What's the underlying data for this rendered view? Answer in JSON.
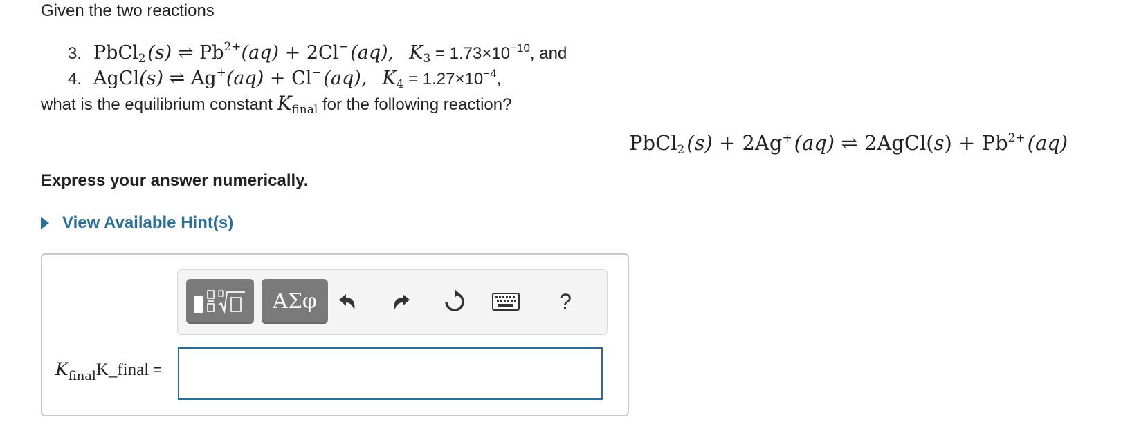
{
  "intro": "Given the two reactions",
  "reactions": [
    {
      "num": "3.",
      "left": "PbCl",
      "left_sub": "2",
      "state1": "(s)",
      "prod1": "Pb",
      "prod1_sup": "2+",
      "aq1": "(aq)",
      "plus": "+",
      "prod2": "2Cl",
      "prod2_sup": "−",
      "aq2": "(aq),",
      "k": "K",
      "k_sub": "3",
      "kval": " = 1.73×10",
      "kval_sup": "−10",
      "tail": ", and"
    },
    {
      "num": "4.",
      "left": "AgCl",
      "state1": "(s)",
      "prod1": "Ag",
      "prod1_sup": "+",
      "aq1": "(aq)",
      "plus": "+",
      "prod2": "Cl",
      "prod2_sup": "−",
      "aq2": "(aq),",
      "k": "K",
      "k_sub": "4",
      "kval": " = 1.27×10",
      "kval_sup": "−4",
      "tail": ","
    }
  ],
  "question": {
    "before": "what is the equilibrium constant ",
    "k": "K",
    "k_sub": "final",
    "after": " for the following reaction?"
  },
  "final_reaction": {
    "a": "PbCl",
    "a_sub": "2",
    "a_state": "(s)",
    "plus1": "+",
    "b": "2Ag",
    "b_sup": "+",
    "b_state": "(aq)",
    "arrow": "⇌",
    "c": "2AgCl(",
    "c_state": "s",
    "c_end": ")",
    "plus2": "+",
    "d": "Pb",
    "d_sup": "2+",
    "d_state": "(aq)"
  },
  "instruction": "Express your answer numerically.",
  "hint_link": "View Available Hint(s)",
  "toolbar": {
    "greek_label": "ΑΣφ",
    "help_label": "?"
  },
  "answer": {
    "label_k": "K",
    "label_sub": "final",
    "label_plain": "K_final",
    "label_eq": "=",
    "value": ""
  },
  "icons": [
    "templates-icon",
    "undo-icon",
    "redo-icon",
    "reset-icon",
    "keyboard-icon",
    "help-icon"
  ],
  "colors": {
    "link": "#2a6e94",
    "input_border": "#2a6e94",
    "button_gray": "#7a7a7a"
  }
}
